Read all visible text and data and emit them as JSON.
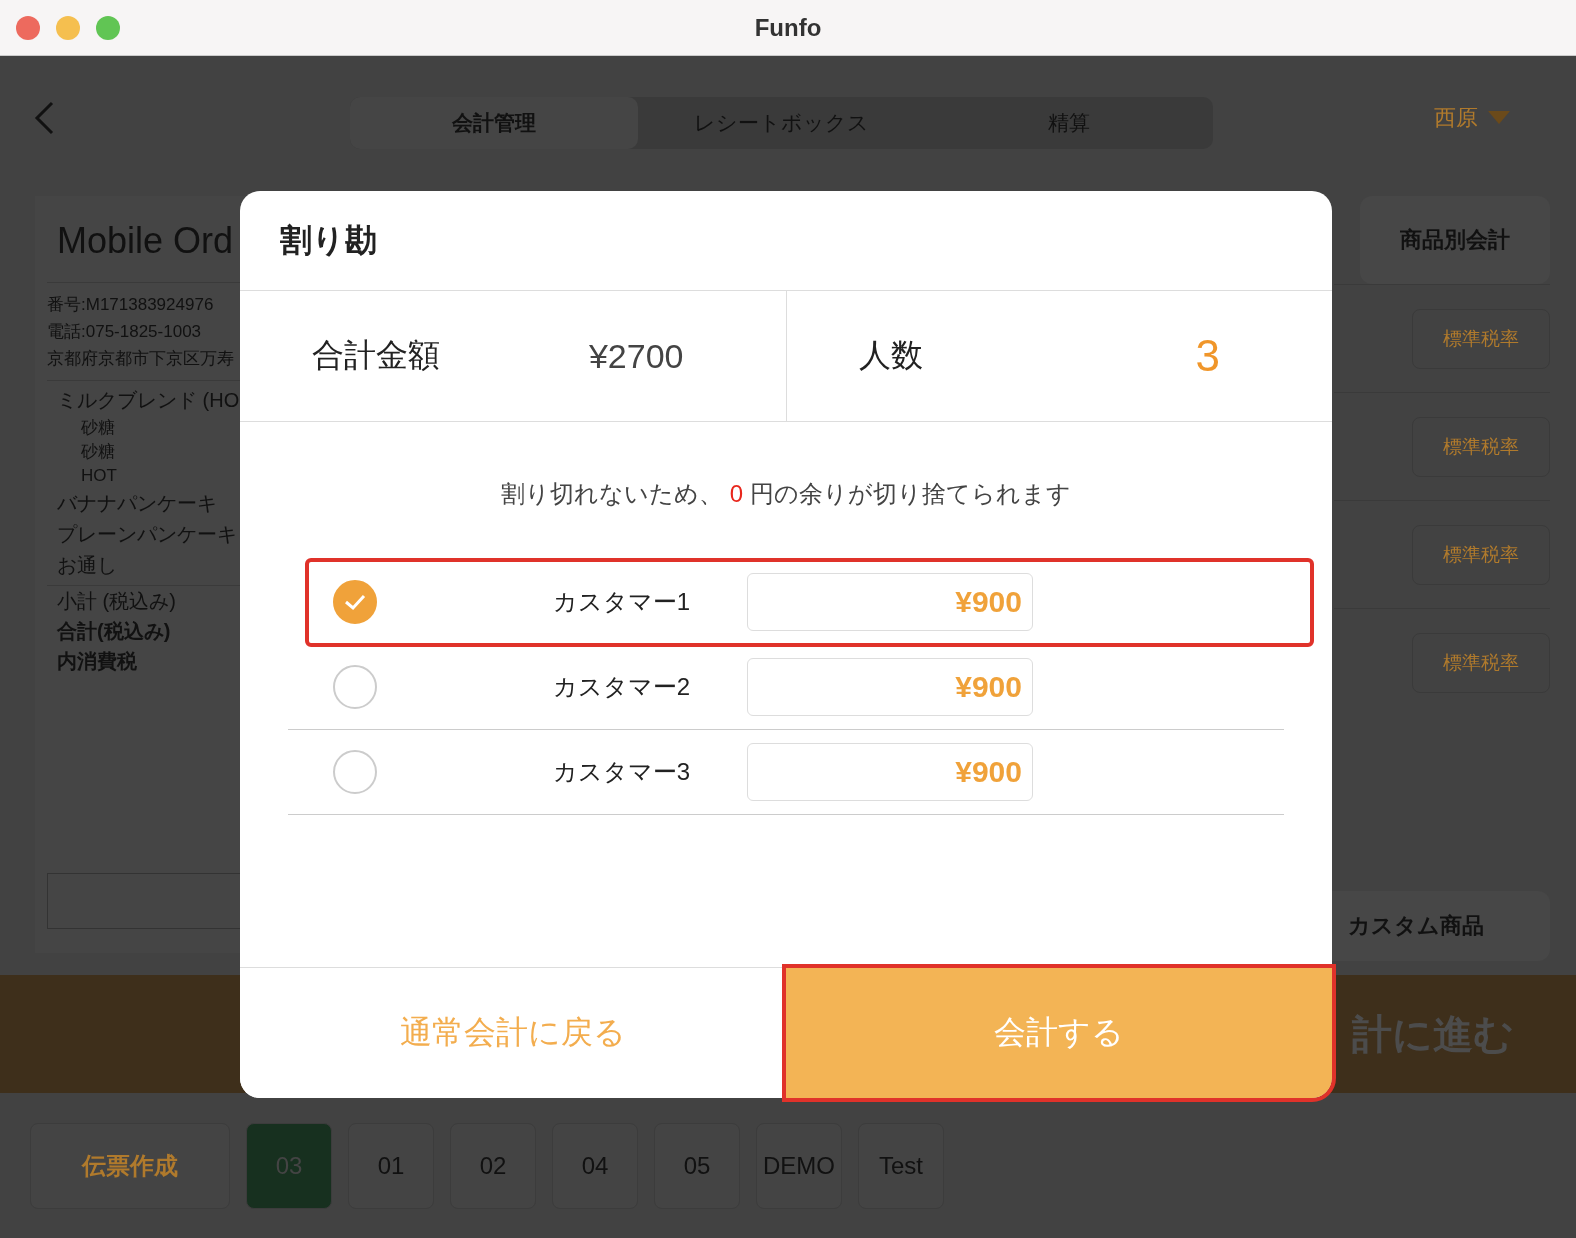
{
  "window": {
    "title": "Funfo"
  },
  "header": {
    "tabs": [
      {
        "label": "会計管理",
        "selected": true
      },
      {
        "label": "レシートボックス",
        "selected": false
      },
      {
        "label": "精算",
        "selected": false
      }
    ],
    "user": "西原"
  },
  "order": {
    "title": "Mobile Ord",
    "info": [
      "番号:M171383924976",
      "電話:075-1825-1003",
      "京都府京都市下京区万寿"
    ],
    "items": [
      {
        "name": "ミルクブレンド (HO",
        "options": [
          "砂糖",
          "砂糖",
          "HOT"
        ]
      },
      {
        "name": "バナナパンケーキ"
      },
      {
        "name": "プレーンパンケーキ"
      },
      {
        "name": "お通し"
      }
    ],
    "totals": [
      "小計 (税込み)",
      "合計(税込み)",
      "内消費税"
    ]
  },
  "side": {
    "split_button": "商品別会計",
    "tax_buttons": [
      "標準税率",
      "標準税率",
      "標準税率",
      "標準税率"
    ],
    "custom_button": "カスタム商品",
    "proceed_button": "計に進む"
  },
  "bottom": {
    "create_button": "伝票作成",
    "tables": [
      {
        "label": "03",
        "selected": true
      },
      {
        "label": "01",
        "selected": false
      },
      {
        "label": "02",
        "selected": false
      },
      {
        "label": "04",
        "selected": false
      },
      {
        "label": "05",
        "selected": false
      },
      {
        "label": "DEMO",
        "selected": false
      },
      {
        "label": "Test",
        "selected": false
      }
    ]
  },
  "modal": {
    "title": "割り勘",
    "total_label": "合計金額",
    "total": "¥2700",
    "people_label": "人数",
    "people": "3",
    "notice_before": "割り切れないため、",
    "remainder": "0",
    "notice_after": "円の余りが切り捨てられます",
    "customers": [
      {
        "name": "カスタマー1",
        "amount": "¥900",
        "checked": true,
        "highlighted": true
      },
      {
        "name": "カスタマー2",
        "amount": "¥900",
        "checked": false,
        "highlighted": false
      },
      {
        "name": "カスタマー3",
        "amount": "¥900",
        "checked": false,
        "highlighted": false
      }
    ],
    "back_button": "通常会計に戻る",
    "pay_button": {
      "label": "会計する",
      "highlighted": true
    }
  }
}
